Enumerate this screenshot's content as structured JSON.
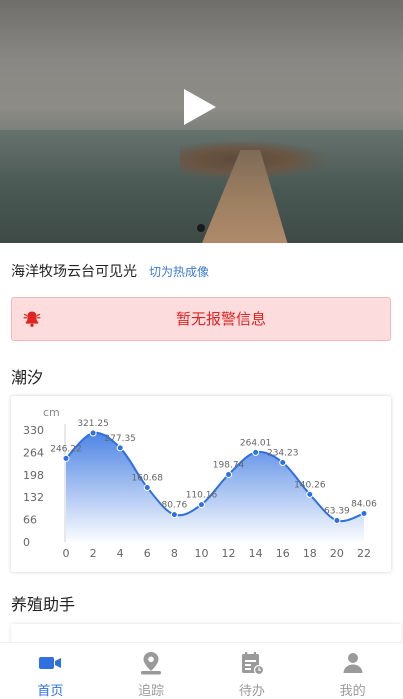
{
  "video": {
    "play_icon": "play-icon"
  },
  "camera": {
    "name": "海洋牧场云台可见光",
    "switch_label": "切为热成像"
  },
  "alarm": {
    "icon": "bell-icon",
    "text": "暂无报警信息",
    "color": "#e02424"
  },
  "tide": {
    "title": "潮汐",
    "chart_data": {
      "type": "line",
      "ylabel": "cm",
      "x": [
        0,
        2,
        4,
        6,
        8,
        10,
        12,
        14,
        16,
        18,
        20,
        22
      ],
      "y_ticks": [
        0,
        66,
        132,
        198,
        264,
        330
      ],
      "ylim": [
        0,
        330
      ],
      "points": [
        {
          "x": 0,
          "y": 246.22
        },
        {
          "x": 2,
          "y": 321.25
        },
        {
          "x": 4,
          "y": 277.35
        },
        {
          "x": 6,
          "y": 160.68
        },
        {
          "x": 8,
          "y": 80.76
        },
        {
          "x": 10,
          "y": 110.16
        },
        {
          "x": 12,
          "y": 198.74
        },
        {
          "x": 14,
          "y": 264.01
        },
        {
          "x": 16,
          "y": 234.23
        },
        {
          "x": 18,
          "y": 140.26
        },
        {
          "x": 20,
          "y": 63.39
        },
        {
          "x": 22,
          "y": 84.06
        }
      ],
      "grid": false,
      "area_fill": true,
      "color": "#2f6fe0"
    }
  },
  "assistant": {
    "title": "养殖助手"
  },
  "tabbar": {
    "items": [
      {
        "label": "首页",
        "icon": "video-camera-icon",
        "active": true
      },
      {
        "label": "追踪",
        "icon": "location-pin-icon",
        "active": false
      },
      {
        "label": "待办",
        "icon": "todo-calendar-icon",
        "active": false
      },
      {
        "label": "我的",
        "icon": "user-icon",
        "active": false
      }
    ]
  }
}
